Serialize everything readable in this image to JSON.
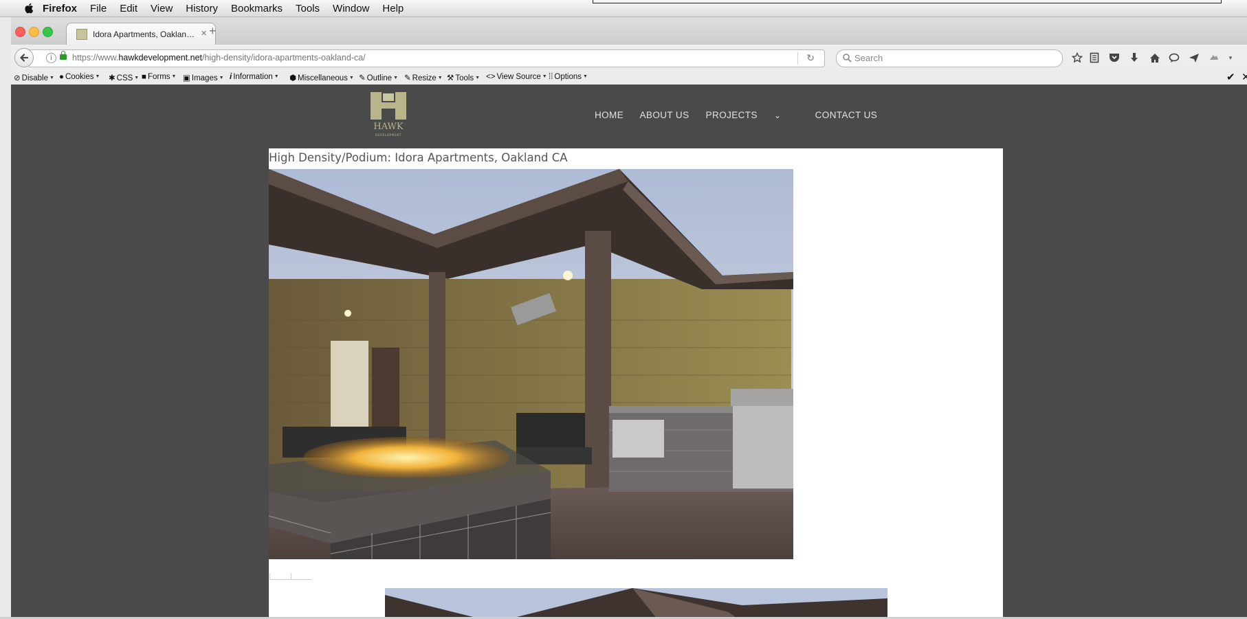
{
  "menubar": {
    "app_name": "Firefox",
    "items": [
      "File",
      "Edit",
      "View",
      "History",
      "Bookmarks",
      "Tools",
      "Window",
      "Help"
    ]
  },
  "tab": {
    "title": "Idora Apartments, Oaklan…",
    "close": "×",
    "new_tab": "+"
  },
  "navbar": {
    "url_domain": "https://www.hawkdevelopment.net",
    "url_prefix_muted": "https://www.",
    "url_host": "hawkdevelopment.net",
    "url_path": "/high-density/idora-apartments-oakland-ca/",
    "search_placeholder": "Search"
  },
  "devbar": {
    "items": [
      "Disable",
      "Cookies",
      "CSS",
      "Forms",
      "Images",
      "Information",
      "Miscellaneous",
      "Outline",
      "Resize",
      "Tools",
      "View Source",
      "Options"
    ]
  },
  "site": {
    "logo_text": "HAWK",
    "logo_subtext": "DEVELOPMENT",
    "nav": [
      "HOME",
      "ABOUT US",
      "PROJECTS",
      "CONTACT US"
    ],
    "projects_caret": "⌄",
    "page_title": "High Density/Podium: Idora Apartments, Oakland CA"
  },
  "colors": {
    "page_background": "#4a4a4a",
    "logo_color": "#b9b58b",
    "nav_text": "#e2e2e2"
  }
}
